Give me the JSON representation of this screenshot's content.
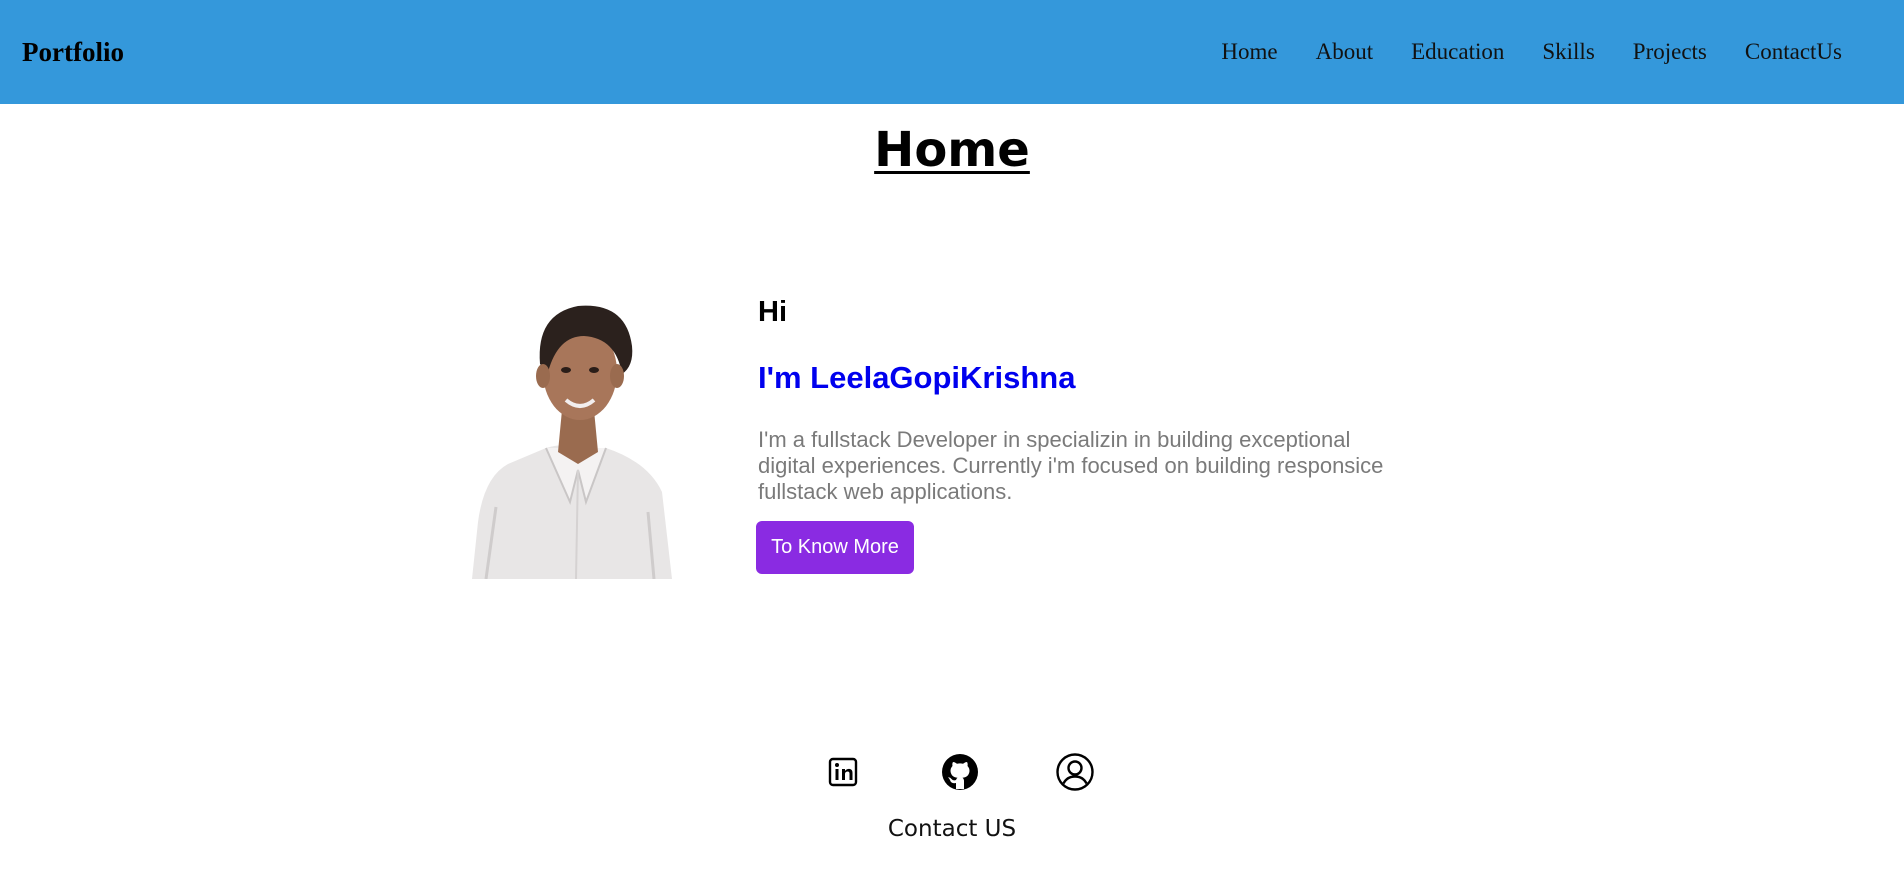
{
  "navbar": {
    "brand": "Portfolio",
    "links": [
      "Home",
      "About",
      "Education",
      "Skills",
      "Projects",
      "ContactUs"
    ]
  },
  "home": {
    "title": "Home",
    "greeting": "Hi",
    "name": "I'm LeelaGopiKrishna",
    "description": "I'm a fullstack Developer in specializin in building exceptional digital experiences. Currently i'm focused on building responsice fullstack web applications.",
    "button_label": "To Know More"
  },
  "social": {
    "icons": [
      "linkedin-icon",
      "github-icon",
      "profile-icon"
    ],
    "contact_label": "Contact US"
  },
  "colors": {
    "navbar_bg": "#3498db",
    "name_color": "#0000ee",
    "button_bg": "#8a2be2",
    "description_color": "#7a7a7a"
  }
}
